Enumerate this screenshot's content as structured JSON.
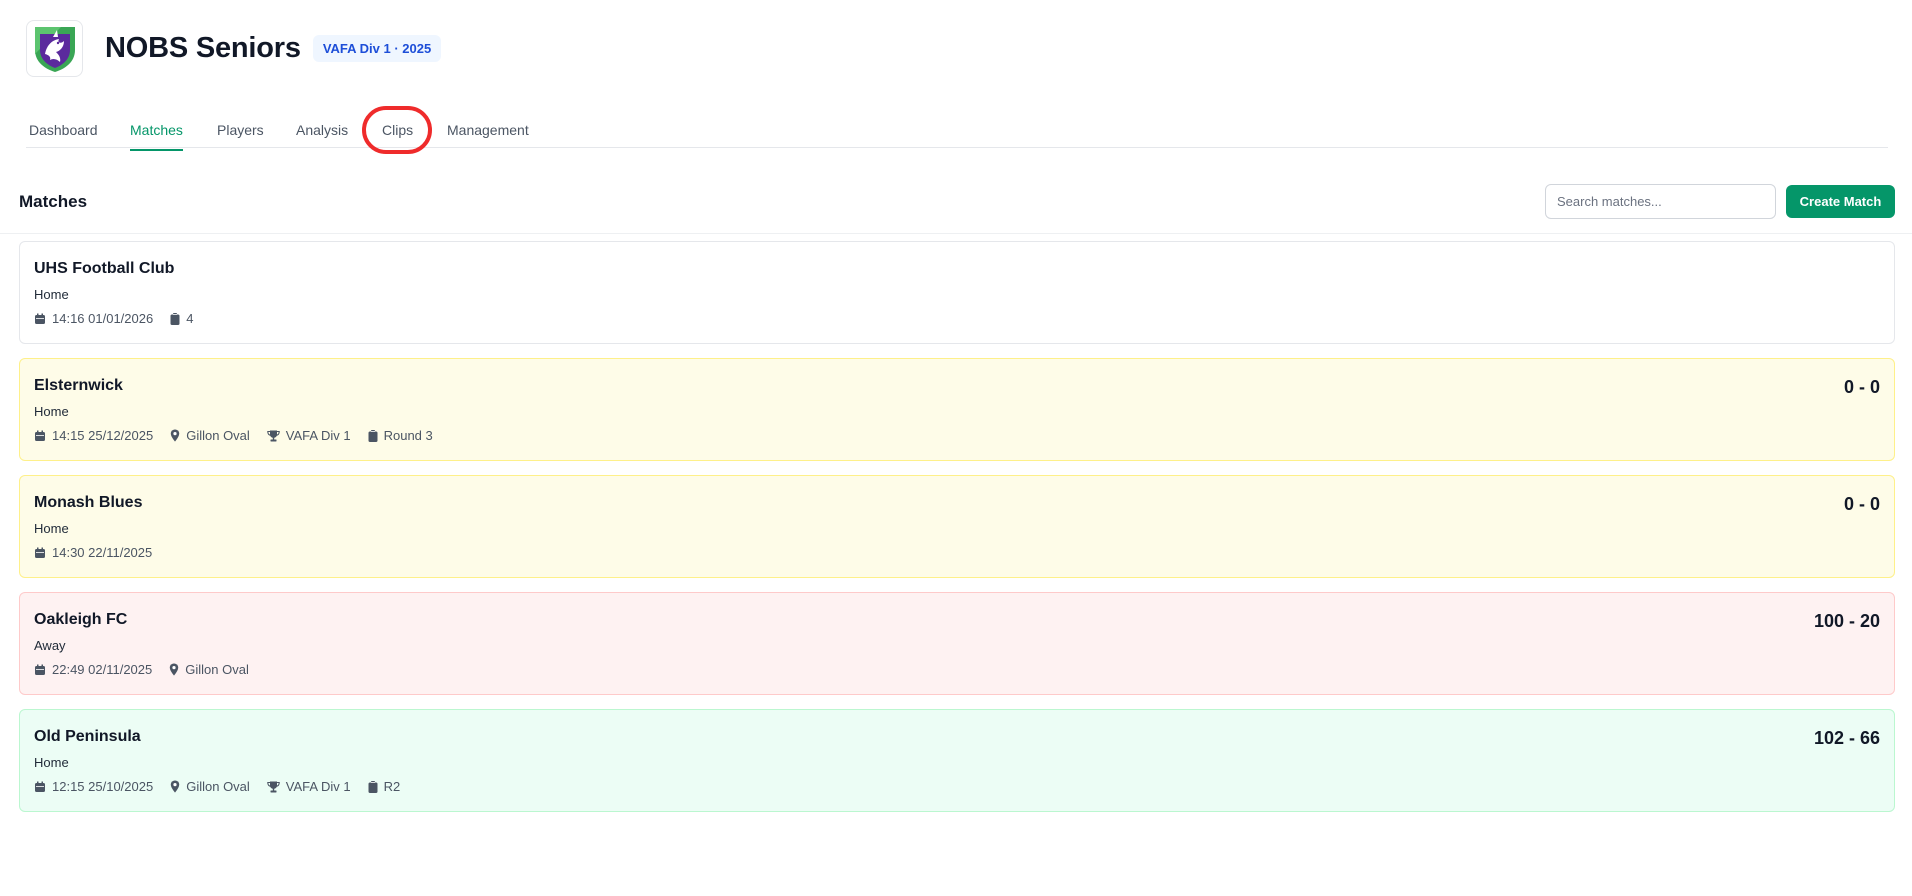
{
  "team": {
    "name": "NOBS Seniors",
    "badge": "VAFA Div 1 · 2025"
  },
  "tabs": [
    {
      "label": "Dashboard"
    },
    {
      "label": "Matches",
      "active": true
    },
    {
      "label": "Players"
    },
    {
      "label": "Analysis"
    },
    {
      "label": "Clips"
    },
    {
      "label": "Management"
    }
  ],
  "matches_section": {
    "title": "Matches",
    "search_placeholder": "Search matches...",
    "create_label": "Create Match"
  },
  "matches": [
    {
      "opponent": "UHS Football Club",
      "venue_type": "Home",
      "datetime": "14:16 01/01/2026",
      "round": "4",
      "result": "none"
    },
    {
      "opponent": "Elsternwick",
      "venue_type": "Home",
      "score": "0 - 0",
      "datetime": "14:15 25/12/2025",
      "location": "Gillon Oval",
      "competition": "VAFA Div 1",
      "round": "Round 3",
      "result": "draw"
    },
    {
      "opponent": "Monash Blues",
      "venue_type": "Home",
      "score": "0 - 0",
      "datetime": "14:30 22/11/2025",
      "result": "draw"
    },
    {
      "opponent": "Oakleigh FC",
      "venue_type": "Away",
      "score": "100 - 20",
      "datetime": "22:49 02/11/2025",
      "location": "Gillon Oval",
      "result": "loss"
    },
    {
      "opponent": "Old Peninsula",
      "venue_type": "Home",
      "score": "102 - 66",
      "datetime": "12:15 25/10/2025",
      "location": "Gillon Oval",
      "competition": "VAFA Div 1",
      "round": "R2",
      "result": "win"
    }
  ],
  "colors": {
    "accent": "#059669",
    "badge_bg": "#eff6ff",
    "badge_text": "#1d4ed8",
    "draw_bg": "#fefce8",
    "loss_bg": "#fef2f2",
    "win_bg": "#ecfdf5",
    "highlight": "#ef2b2b"
  },
  "icons": {
    "datetime": "calendar-icon",
    "location": "map-pin-icon",
    "competition": "trophy-icon",
    "round": "clipboard-icon"
  }
}
